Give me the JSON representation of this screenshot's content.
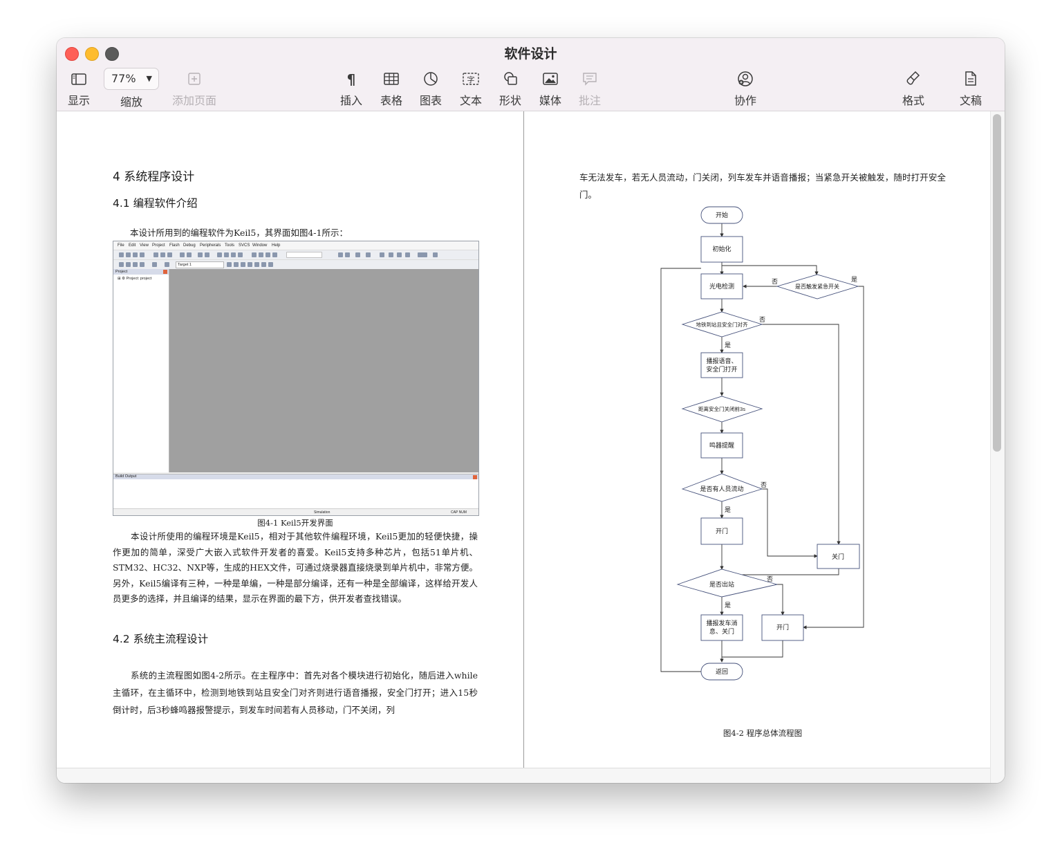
{
  "window": {
    "title": "软件设计"
  },
  "toolbar": {
    "view": "显示",
    "zoom_value": "77%",
    "zoom_label": "缩放",
    "add_page": "添加页面",
    "insert": "插入",
    "table": "表格",
    "chart": "图表",
    "text": "文本",
    "shape": "形状",
    "media": "媒体",
    "comment": "批注",
    "collaborate": "协作",
    "format": "格式",
    "document": "文稿"
  },
  "left_page": {
    "h1": "4 系统程序设计",
    "h2_1": "4.1 编程软件介绍",
    "intro": "本设计所用到的编程软件为Keil5，其界面如图4-1所示：",
    "fig1_caption": "图4-1 Keil5开发界面",
    "para1": "本设计所使用的编程环境是Keil5，相对于其他软件编程环境，Keil5更加的轻便快捷，操作更加的简单，深受广大嵌入式软件开发者的喜爱。Keil5支持多种芯片，包括51单片机、STM32、HC32、NXP等，生成的HEX文件，可通过烧录器直接烧录到单片机中，非常方便。另外，Keil5编译有三种，一种是单编，一种是部分编译，还有一种是全部编译，这样给开发人员更多的选择，并且编译的结果，显示在界面的最下方，供开发者查找错误。",
    "h2_2": "4.2 系统主流程设计",
    "para2": "系统的主流程图如图4-2所示。在主程序中：首先对各个模块进行初始化，随后进入while主循环，在主循环中，检测到地铁到站且安全门对齐则进行语音播报，安全门打开；进入15秒倒计时，后3秒蜂鸣器报警提示，到发车时间若有人员移动，门不关闭，列"
  },
  "keil": {
    "menu": [
      "File",
      "Edit",
      "View",
      "Project",
      "Flash",
      "Debug",
      "Peripherals",
      "Tools",
      "SVCS",
      "Window",
      "Help"
    ],
    "target": "Target 1",
    "project_panel": "Project",
    "project_item": "Project: project",
    "build_panel": "Build Output",
    "status_sim": "Simulation",
    "status_caps": "CAP  NUM"
  },
  "right_page": {
    "para": "车无法发车，若无人员流动，门关闭，列车发车并语音播报；当紧急开关被触发，随时打开安全门。",
    "fig2_caption": "图4-2   程序总体流程图"
  },
  "flowchart": {
    "start": "开始",
    "init": "初始化",
    "photo": "光电检测",
    "emergency": "是否触发紧急开关",
    "arrived": "地铁到站且安全门对齐",
    "announce_l1": "播报语音、",
    "announce_l2": "安全门打开",
    "countdown": "距离安全门关闭前3s",
    "buzzer": "鸣器提醒",
    "people": "是否有人员流动",
    "open1": "开门",
    "close": "关门",
    "depart": "是否出站",
    "broadcast_l1": "播报发车消",
    "broadcast_l2": "息、关门",
    "open2": "开门",
    "return": "返回",
    "yes": "是",
    "no": "否"
  }
}
